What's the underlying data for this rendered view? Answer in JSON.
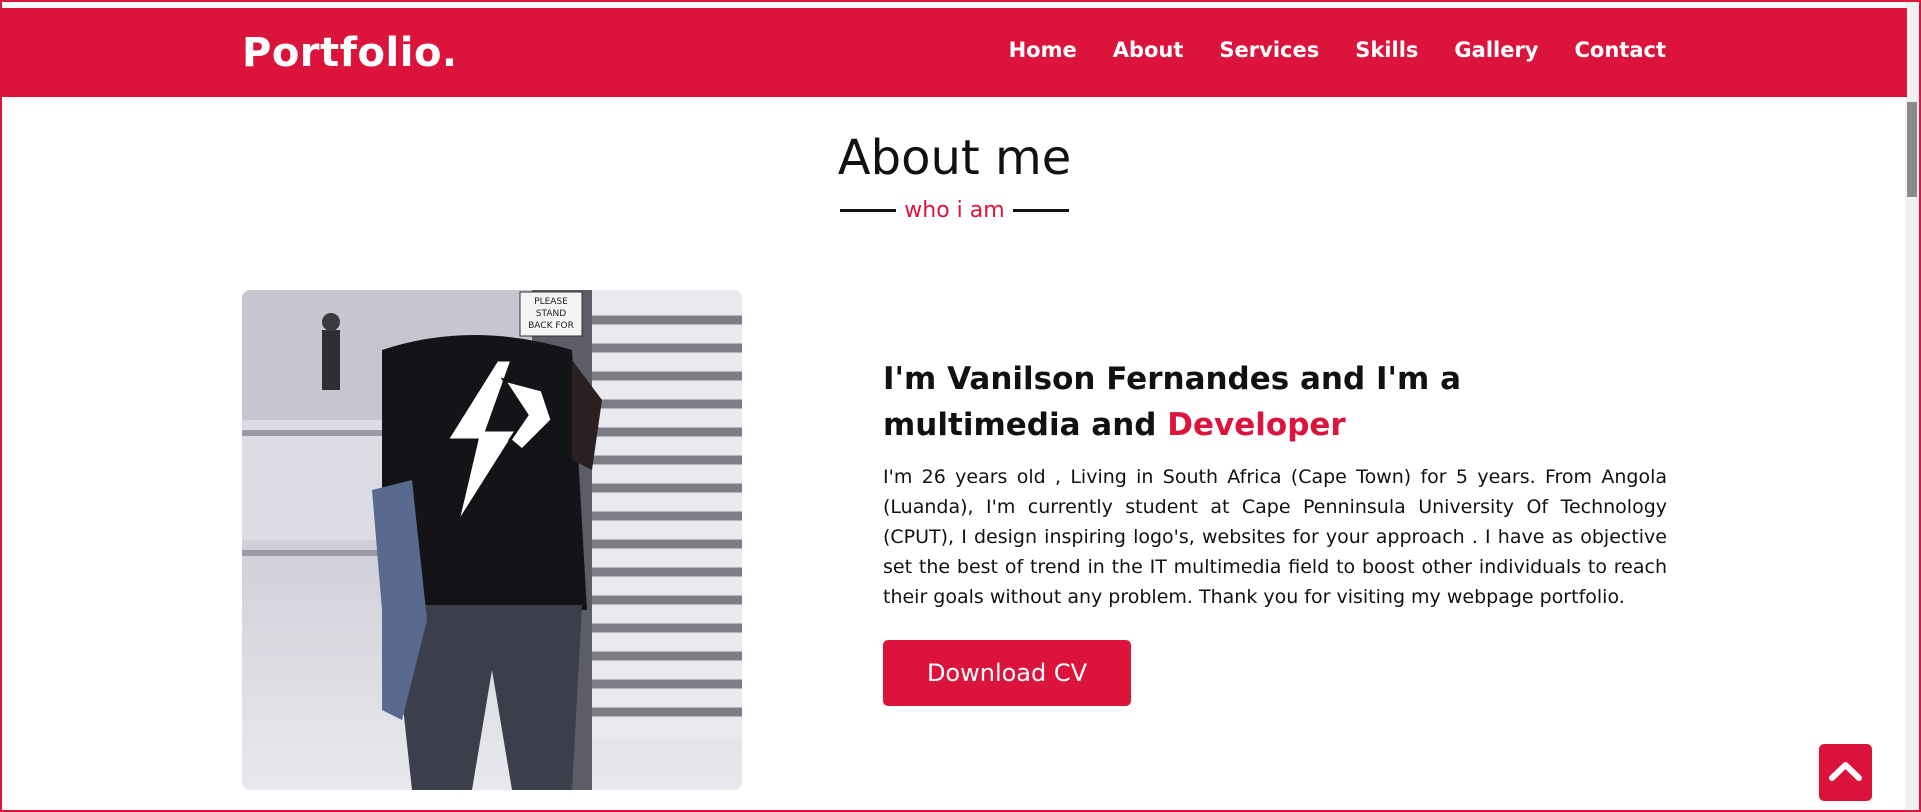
{
  "nav": {
    "logo": "Portfolio.",
    "items": [
      "Home",
      "About",
      "Services",
      "Skills",
      "Gallery",
      "Contact"
    ]
  },
  "about": {
    "title": "About me",
    "subtitle": "who i am",
    "headline_main": "I'm Vanilson Fernandes and I'm a multimedia and ",
    "headline_accent": "Developer",
    "bio": "I'm 26 years old , Living in South Africa (Cape Town) for 5 years. From Angola (Luanda), I'm currently student at Cape Penninsula University Of Technology (CPUT), I design inspiring logo's, websites for your approach . I have as objective set the best of trend in the IT multimedia field to boost other individuals to reach their goals without any problem. Thank you for visiting my webpage portfolio.",
    "cv_button": "Download CV",
    "photo_sign": "PLEASE STAND BACK FOR"
  },
  "colors": {
    "accent": "#dc143c",
    "text": "#111111",
    "background": "#ffffff"
  },
  "icons": {
    "scroll_top": "chevron-up-icon"
  }
}
